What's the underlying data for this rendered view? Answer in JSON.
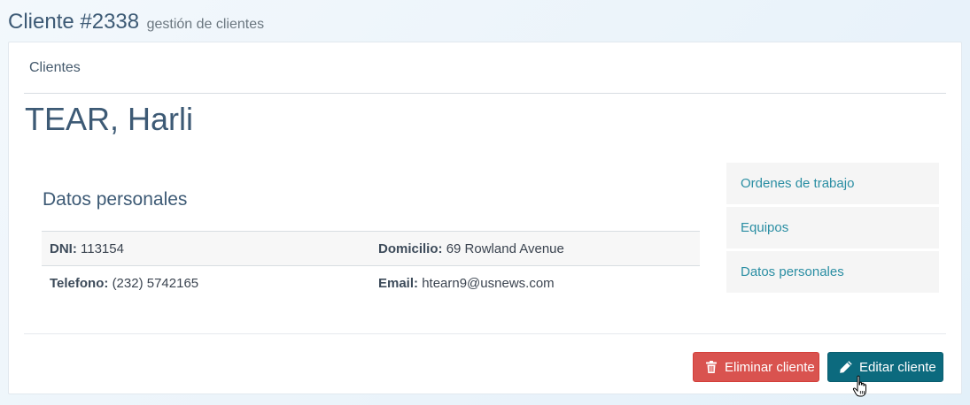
{
  "header": {
    "title": "Cliente #2338",
    "subtitle": "gestión de clientes"
  },
  "panel": {
    "heading": "Clientes"
  },
  "client": {
    "name": "TEAR, Harli"
  },
  "personal_data": {
    "title": "Datos personales",
    "rows": [
      [
        {
          "label": "DNI:",
          "value": "113154"
        },
        {
          "label": "Domicilio:",
          "value": "69 Rowland Avenue"
        }
      ],
      [
        {
          "label": "Telefono:",
          "value": "(232) 5742165"
        },
        {
          "label": "Email:",
          "value": "htearn9@usnews.com"
        }
      ]
    ]
  },
  "sidebar": {
    "items": [
      {
        "label": "Ordenes de trabajo"
      },
      {
        "label": "Equipos"
      },
      {
        "label": "Datos personales"
      }
    ]
  },
  "actions": {
    "delete_label": "Eliminar cliente",
    "delete_icon": "trash-icon",
    "edit_label": "Editar cliente",
    "edit_icon": "pencil-icon"
  },
  "colors": {
    "title": "#3d5a75",
    "link": "#2a8ea3",
    "danger": "#d9534f",
    "primary": "#0c6a7e"
  }
}
